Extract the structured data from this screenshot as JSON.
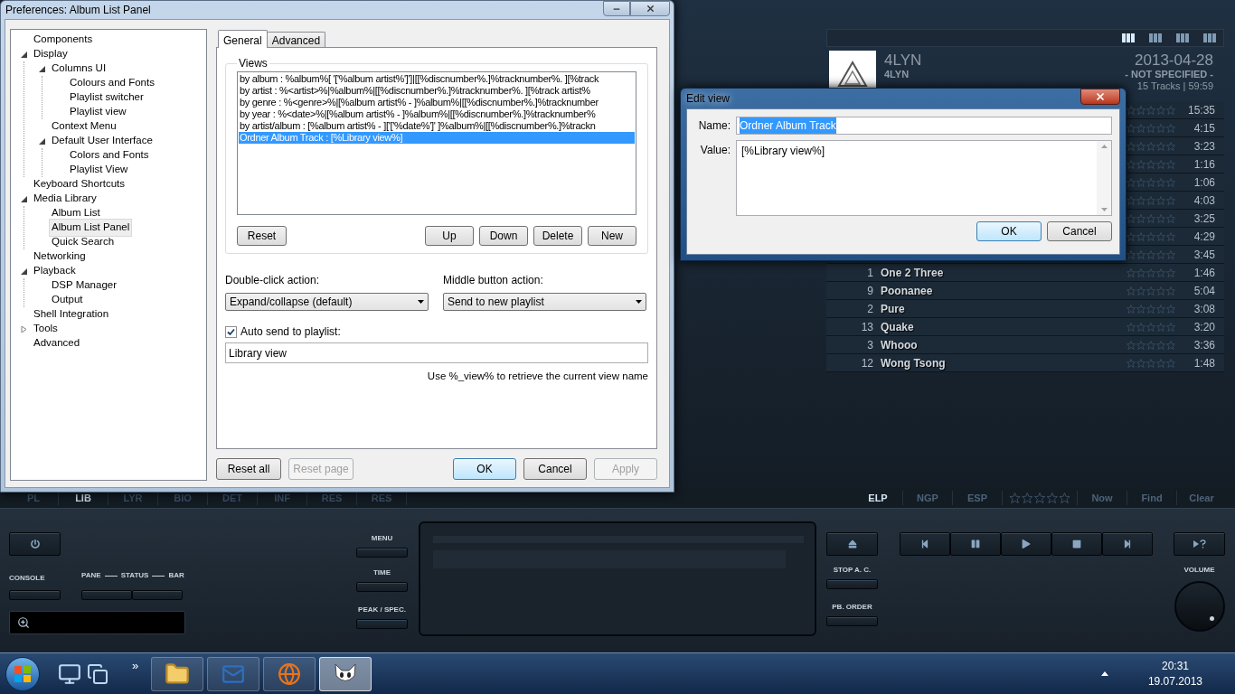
{
  "preferences": {
    "title": "Preferences: Album List Panel",
    "tree": [
      {
        "label": "Components",
        "selected": false
      },
      {
        "label": "Display",
        "selected": false,
        "expanded": true,
        "children": [
          {
            "label": "Columns UI",
            "selected": false,
            "expanded": true,
            "children": [
              {
                "label": "Colours and Fonts",
                "selected": false
              },
              {
                "label": "Playlist switcher",
                "selected": false
              },
              {
                "label": "Playlist view",
                "selected": false
              }
            ]
          },
          {
            "label": "Context Menu",
            "selected": false
          },
          {
            "label": "Default User Interface",
            "selected": false,
            "expanded": true,
            "children": [
              {
                "label": "Colors and Fonts",
                "selected": false
              },
              {
                "label": "Playlist View",
                "selected": false
              }
            ]
          }
        ]
      },
      {
        "label": "Keyboard Shortcuts",
        "selected": false
      },
      {
        "label": "Media Library",
        "selected": false,
        "expanded": true,
        "children": [
          {
            "label": "Album List",
            "selected": false
          },
          {
            "label": "Album List Panel",
            "selected": true
          },
          {
            "label": "Quick Search",
            "selected": false
          }
        ]
      },
      {
        "label": "Networking",
        "selected": false
      },
      {
        "label": "Playback",
        "selected": false,
        "expanded": true,
        "children": [
          {
            "label": "DSP Manager",
            "selected": false
          },
          {
            "label": "Output",
            "selected": false
          }
        ]
      },
      {
        "label": "Shell Integration",
        "selected": false
      },
      {
        "label": "Tools",
        "selected": false,
        "expanded": false
      },
      {
        "label": "Advanced",
        "selected": false
      }
    ],
    "tabs": [
      {
        "label": "General",
        "selected": true
      },
      {
        "label": "Advanced",
        "selected": false
      }
    ],
    "views": {
      "label": "Views",
      "items": [
        {
          "text": "by album : %album%[ '['%album artist%']']|[[%discnumber%.]%tracknumber%. ][%track",
          "selected": false
        },
        {
          "text": "by artist : %<artist>%|%album%|[[%discnumber%.]%tracknumber%. ][%track artist%",
          "selected": false
        },
        {
          "text": "by genre : %<genre>%|[%album artist% - ]%album%|[[%discnumber%.]%tracknumber",
          "selected": false
        },
        {
          "text": "by year : %<date>%|[%album artist% - ]%album%|[[%discnumber%.]%tracknumber%",
          "selected": false
        },
        {
          "text": "by artist/album : [%album artist% - ]['['%date%']' ]%album%|[[%discnumber%.]%trackn",
          "selected": false
        },
        {
          "text": "Ordner Album Track : [%Library view%]",
          "selected": true
        }
      ],
      "left_buttons": [
        "Reset"
      ],
      "right_buttons": [
        "Up",
        "Down",
        "Delete",
        "New"
      ]
    },
    "double_click": {
      "label": "Double-click action:",
      "value": "Expand/collapse (default)"
    },
    "middle_button": {
      "label": "Middle button action:",
      "value": "Send to new playlist"
    },
    "auto_send": {
      "label": "Auto send to playlist:",
      "checked": true,
      "value": "Library view"
    },
    "hint": "Use %_view% to retrieve the current view name",
    "footer_left": [
      {
        "label": "Reset all",
        "disabled": false
      },
      {
        "label": "Reset page",
        "disabled": true
      }
    ],
    "footer_right": [
      {
        "label": "OK",
        "disabled": false,
        "default": true
      },
      {
        "label": "Cancel",
        "disabled": false,
        "default": false
      },
      {
        "label": "Apply",
        "disabled": true,
        "default": false
      }
    ]
  },
  "edit_view": {
    "title": "Edit view",
    "name_label": "Name:",
    "name_value": "Ordner Album Track",
    "name_selected": true,
    "value_label": "Value:",
    "value": "[%Library view%]",
    "buttons": [
      {
        "label": "OK",
        "default": true
      },
      {
        "label": "Cancel",
        "default": false
      }
    ]
  },
  "player": {
    "view_buttons": [
      {
        "selected": true
      },
      {
        "selected": false
      },
      {
        "selected": false
      },
      {
        "selected": false
      }
    ],
    "album": {
      "title": "4LYN",
      "artist": "4LYN",
      "date": "2013-04-28",
      "genre": "- NOT SPECIFIED -",
      "summary": "15 Tracks | 59:59"
    },
    "tracks": [
      {
        "time": "15:35",
        "stars": 0
      },
      {
        "time": "4:15",
        "stars": 0
      },
      {
        "time": "3:23",
        "stars": 0
      },
      {
        "time": "1:16",
        "stars": 0
      },
      {
        "time": "1:06",
        "stars": 0
      },
      {
        "time": "4:03",
        "stars": 0
      },
      {
        "time": "3:25",
        "stars": 0
      },
      {
        "time": "4:29",
        "stars": 0
      },
      {
        "time": "3:45",
        "stars": 0
      },
      {
        "number": "1",
        "title": "One 2 Three",
        "time": "1:46",
        "stars": 0
      },
      {
        "number": "9",
        "title": "Poonanee",
        "time": "5:04",
        "stars": 0
      },
      {
        "number": "2",
        "title": "Pure",
        "time": "3:08",
        "stars": 0
      },
      {
        "number": "13",
        "title": "Quake",
        "time": "3:20",
        "stars": 0
      },
      {
        "number": "3",
        "title": "Whooo",
        "time": "3:36",
        "stars": 0
      },
      {
        "number": "12",
        "title": "Wong Tsong",
        "time": "1:48",
        "stars": 0
      }
    ],
    "panel_tabs": [
      {
        "label": "PL",
        "selected": false
      },
      {
        "label": "LIB",
        "selected": true
      },
      {
        "label": "LYR",
        "selected": false
      },
      {
        "label": "BIO",
        "selected": false
      },
      {
        "label": "DET",
        "selected": false
      },
      {
        "label": "INF",
        "selected": false
      },
      {
        "label": "RES",
        "selected": false
      },
      {
        "label": "RES",
        "selected": false
      }
    ],
    "mode_tabs": [
      {
        "label": "ELP",
        "selected": true
      },
      {
        "label": "NGP",
        "selected": false
      },
      {
        "label": "ESP",
        "selected": false
      }
    ],
    "rating": {
      "stars": 0
    },
    "actions": [
      "Now",
      "Find",
      "Clear"
    ],
    "controls": {
      "console": "CONSOLE",
      "pane": "PANE",
      "status": "STATUS",
      "bar": "BAR",
      "menu": "MENU",
      "time": "TIME",
      "peak": "PEAK / SPEC.",
      "stop_ac": "STOP A. C.",
      "pb_order": "PB. ORDER",
      "volume": "VOLUME"
    }
  },
  "taskbar": {
    "overflow": "»",
    "apps": [
      {
        "kind": "folder",
        "active": false
      },
      {
        "kind": "mail",
        "active": false
      },
      {
        "kind": "browser",
        "active": false
      },
      {
        "kind": "player",
        "active": true
      }
    ],
    "time": "20:31",
    "date": "19.07.2013"
  }
}
